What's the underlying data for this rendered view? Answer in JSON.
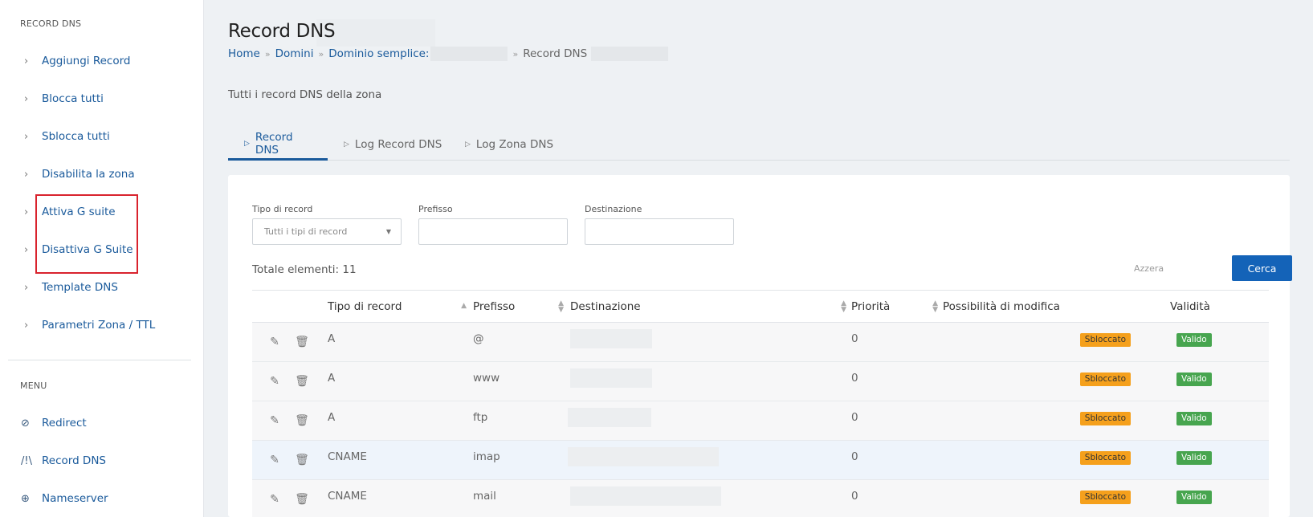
{
  "sidebar": {
    "section_title": "RECORD DNS",
    "items": [
      {
        "label": "Aggiungi Record"
      },
      {
        "label": "Blocca tutti"
      },
      {
        "label": "Sblocca tutti"
      },
      {
        "label": "Disabilita la zona"
      },
      {
        "label": "Attiva G suite"
      },
      {
        "label": "Disattiva G Suite"
      },
      {
        "label": "Template DNS"
      },
      {
        "label": "Parametri Zona / TTL"
      }
    ],
    "menu_title": "MENU",
    "menu": [
      {
        "label": "Redirect",
        "icon": "compass-icon"
      },
      {
        "label": "Record DNS",
        "icon": "record-dns-icon"
      },
      {
        "label": "Nameserver",
        "icon": "globe-icon"
      }
    ],
    "highlight_color": "#d9232d"
  },
  "page": {
    "title": "Record DNS",
    "breadcrumb": {
      "home": "Home",
      "domini": "Domini",
      "dominio": "Dominio semplice:",
      "current": "Record DNS"
    },
    "subtitle": "Tutti i record DNS della zona"
  },
  "tabs": [
    {
      "label": "Record DNS",
      "active": true
    },
    {
      "label": "Log Record DNS",
      "active": false
    },
    {
      "label": "Log Zona DNS",
      "active": false
    }
  ],
  "filters": {
    "tipo_label": "Tipo di record",
    "tipo_value": "Tutti i tipi di record",
    "prefisso_label": "Prefisso",
    "prefisso_value": "",
    "destinazione_label": "Destinazione",
    "destinazione_value": ""
  },
  "summary": {
    "total": "Totale elementi: 11",
    "reset": "Azzera",
    "search": "Cerca"
  },
  "table": {
    "headers": {
      "tipo": "Tipo di record",
      "prefisso": "Prefisso",
      "destinazione": "Destinazione",
      "priorita": "Priorità",
      "modifica": "Possibilità di modifica",
      "validita": "Validità"
    },
    "rows": [
      {
        "tipo": "A",
        "prefisso": "@",
        "priorita": "0",
        "modifica": "Sbloccato",
        "validita": "Valido"
      },
      {
        "tipo": "A",
        "prefisso": "www",
        "priorita": "0",
        "modifica": "Sbloccato",
        "validita": "Valido"
      },
      {
        "tipo": "A",
        "prefisso": "ftp",
        "priorita": "0",
        "modifica": "Sbloccato",
        "validita": "Valido"
      },
      {
        "tipo": "CNAME",
        "prefisso": "imap",
        "priorita": "0",
        "modifica": "Sbloccato",
        "validita": "Valido"
      },
      {
        "tipo": "CNAME",
        "prefisso": "mail",
        "priorita": "0",
        "modifica": "Sbloccato",
        "validita": "Valido"
      }
    ]
  },
  "colors": {
    "link": "#1a5a9b",
    "primary_button": "#1463b8",
    "badge_unlocked": "#f5a01c",
    "badge_valid": "#47a54f"
  }
}
